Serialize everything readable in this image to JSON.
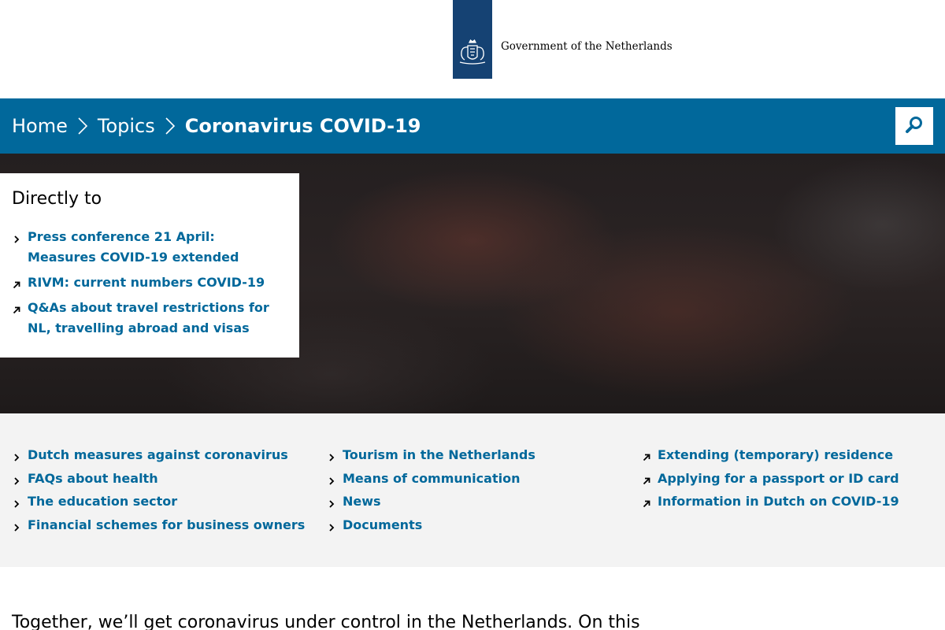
{
  "header": {
    "logo_text": "Government of the Netherlands",
    "logo_icon": "netherlands-coat-of-arms-icon",
    "brand_color": "#154273"
  },
  "breadcrumb": {
    "items": [
      "Home",
      "Topics",
      "Coronavirus COVID-19"
    ],
    "bar_color": "#01689b",
    "search_icon": "search-icon"
  },
  "directly_to": {
    "title": "Directly to",
    "links": [
      {
        "label": "Press conference 21 April: Measures COVID-19 extended",
        "icon": "chevron-right-icon"
      },
      {
        "label": "RIVM: current numbers COVID-19",
        "icon": "external-arrow-icon"
      },
      {
        "label": "Q&As about travel restrictions for NL, travelling abroad and visas",
        "icon": "external-arrow-icon"
      }
    ]
  },
  "topic_links": {
    "col1": [
      {
        "label": "Dutch measures against coronavirus",
        "icon": "chevron-right-icon"
      },
      {
        "label": "FAQs about health",
        "icon": "chevron-right-icon"
      },
      {
        "label": "The education sector",
        "icon": "chevron-right-icon"
      },
      {
        "label": "Financial schemes for business owners",
        "icon": "chevron-right-icon"
      }
    ],
    "col2": [
      {
        "label": "Tourism in the Netherlands",
        "icon": "chevron-right-icon"
      },
      {
        "label": "Means of communication",
        "icon": "chevron-right-icon"
      },
      {
        "label": "News",
        "icon": "chevron-right-icon"
      },
      {
        "label": "Documents",
        "icon": "chevron-right-icon"
      }
    ],
    "col3": [
      {
        "label": "Extending (temporary) residence",
        "icon": "external-arrow-icon"
      },
      {
        "label": "Applying for a passport or ID card",
        "icon": "external-arrow-icon"
      },
      {
        "label": "Information in Dutch on COVID-19",
        "icon": "external-arrow-icon"
      }
    ]
  },
  "intro": {
    "text": "Together, we’ll get coronavirus under control in the Netherlands. On this"
  },
  "colors": {
    "link": "#01689b",
    "section_bg": "#f3f3f3"
  }
}
